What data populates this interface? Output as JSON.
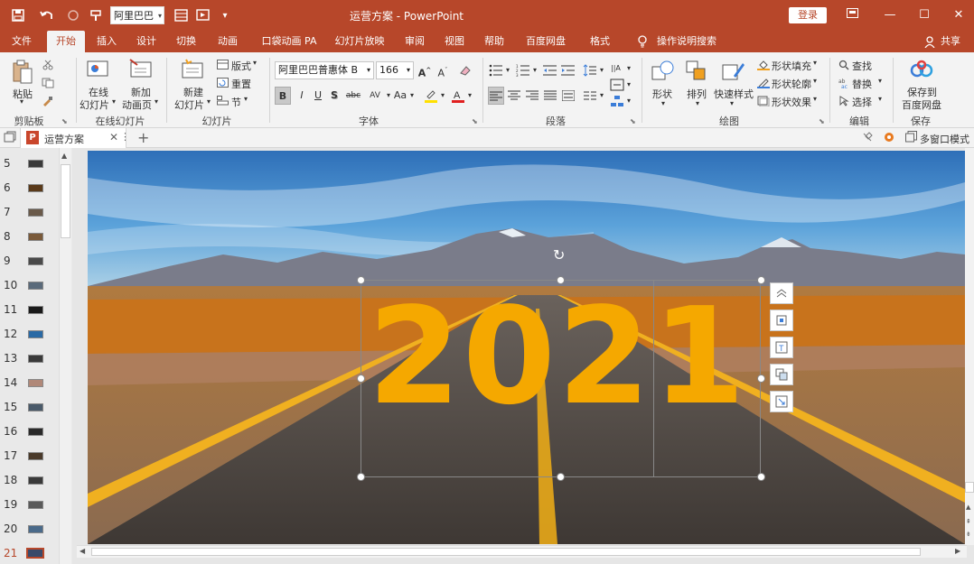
{
  "titlebar": {
    "font_box_value": "阿里巴巴",
    "title": "运营方案 - PowerPoint",
    "login_label": "登录"
  },
  "menu": [
    {
      "label": "文件"
    },
    {
      "label": "开始"
    },
    {
      "label": "插入"
    },
    {
      "label": "设计"
    },
    {
      "label": "切换"
    },
    {
      "label": "动画"
    },
    {
      "label": "口袋动画 PA"
    },
    {
      "label": "幻灯片放映"
    },
    {
      "label": "审阅"
    },
    {
      "label": "视图"
    },
    {
      "label": "帮助"
    },
    {
      "label": "百度网盘"
    },
    {
      "label": "格式"
    },
    {
      "label": "操作说明搜索"
    },
    {
      "label": "共享"
    }
  ],
  "ribbon": {
    "clipboard": {
      "paste": "粘贴",
      "group": "剪贴板"
    },
    "online": {
      "online_slides_1": "在线",
      "online_slides_2": "幻灯片",
      "new_anim_1": "新加",
      "new_anim_2": "动画页",
      "group": "在线幻灯片"
    },
    "slides": {
      "new_1": "新建",
      "new_2": "幻灯片",
      "layout": "版式",
      "reset": "重置",
      "section": "节",
      "group": "幻灯片"
    },
    "font": {
      "family": "阿里巴巴普惠体 B",
      "size": "166",
      "bold": "B",
      "italic": "I",
      "underline": "U",
      "shadow": "S",
      "strike": "abc",
      "spacing": "AV",
      "case": "Aa",
      "group": "字体"
    },
    "paragraph": {
      "group": "段落"
    },
    "drawing": {
      "shape": "形状",
      "arrange": "排列",
      "quick_style": "快速样式",
      "fill": "形状填充",
      "outline": "形状轮廓",
      "effect": "形状效果",
      "group": "绘图"
    },
    "editing": {
      "find": "查找",
      "replace": "替换",
      "select": "选择",
      "group": "编辑"
    },
    "save": {
      "label_1": "保存到",
      "label_2": "百度网盘",
      "group": "保存"
    }
  },
  "tabstrip": {
    "doc_tab": "运营方案",
    "multiwin": "多窗口模式"
  },
  "thumbnails": [
    {
      "num": "5",
      "color": "#3a3a3a"
    },
    {
      "num": "6",
      "color": "#5a3a1a"
    },
    {
      "num": "7",
      "color": "#6a5a4a"
    },
    {
      "num": "8",
      "color": "#7a5a3a"
    },
    {
      "num": "9",
      "color": "#4a4a4a"
    },
    {
      "num": "10",
      "color": "#5a6a7a"
    },
    {
      "num": "11",
      "color": "#1a1a1a"
    },
    {
      "num": "12",
      "color": "#2a6aa5"
    },
    {
      "num": "13",
      "color": "#3a3a3a"
    },
    {
      "num": "14",
      "color": "#b08878"
    },
    {
      "num": "15",
      "color": "#4a5a6a"
    },
    {
      "num": "16",
      "color": "#2a2a2a"
    },
    {
      "num": "17",
      "color": "#4a3a2a"
    },
    {
      "num": "18",
      "color": "#3a3a3a"
    },
    {
      "num": "19",
      "color": "#5a5a5a"
    },
    {
      "num": "20",
      "color": "#4a6a8a"
    },
    {
      "num": "21",
      "color": "#3a4a6a"
    }
  ],
  "slide": {
    "year": "2021"
  },
  "colors": {
    "accent": "#b7472a",
    "year": "#f5a800",
    "sky": "#3f8fd0",
    "road": "#4a4440"
  }
}
